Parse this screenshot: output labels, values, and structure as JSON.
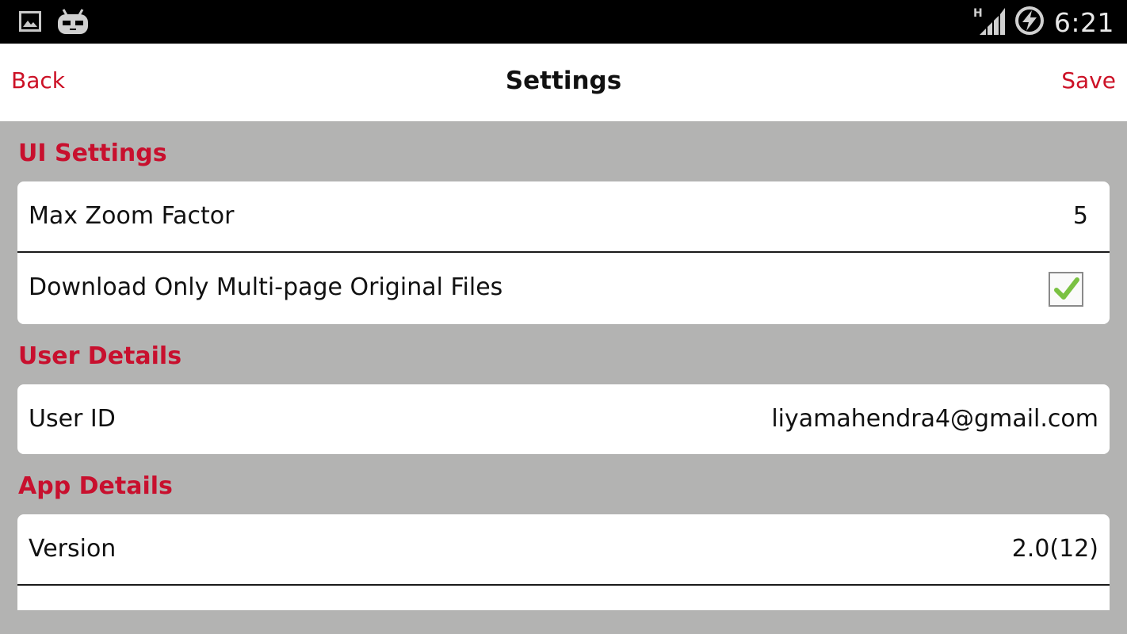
{
  "status_bar": {
    "time": "6:21",
    "network_type": "H",
    "icons": [
      "image-notification-icon",
      "cyanogenmod-mascot-icon",
      "signal-strength-icon",
      "battery-charging-icon"
    ]
  },
  "nav": {
    "back_label": "Back",
    "title": "Settings",
    "save_label": "Save"
  },
  "sections": {
    "ui_settings": {
      "title": "UI Settings",
      "max_zoom": {
        "label": "Max Zoom Factor",
        "value": "5"
      },
      "download_multipage": {
        "label": "Download Only Multi-page Original Files",
        "checked": true
      }
    },
    "user_details": {
      "title": "User Details",
      "user_id": {
        "label": "User ID",
        "value": "liyamahendra4@gmail.com"
      }
    },
    "app_details": {
      "title": "App Details",
      "version": {
        "label": "Version",
        "value": "2.0(12)"
      }
    }
  },
  "colors": {
    "accent": "#c8102e",
    "background": "#b3b3b2",
    "card": "#ffffff",
    "check": "#7ac142"
  }
}
